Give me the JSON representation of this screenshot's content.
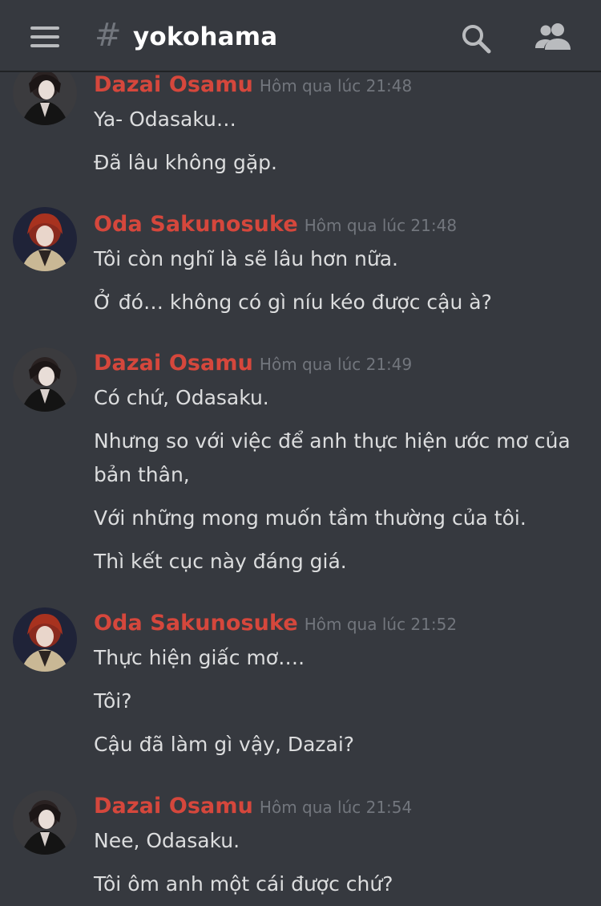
{
  "channel": {
    "hash": "#",
    "name": "yokohama"
  },
  "topbar": {
    "menu_icon": "hamburger-icon",
    "search_icon": "search-icon",
    "members_icon": "members-icon"
  },
  "colors": {
    "background": "#36393f",
    "author": "#d5473c",
    "timestamp": "#72767d",
    "text": "#dcddde",
    "header_border": "#202225"
  },
  "messages": [
    {
      "author": "Dazai Osamu",
      "timestamp": "Hôm qua lúc 21:48",
      "lines": [
        "Ya- Odasaku…",
        "Đã lâu không gặp."
      ]
    },
    {
      "author": "Oda Sakunosuke",
      "timestamp": "Hôm qua lúc 21:48",
      "lines": [
        "Tôi còn nghĩ là sẽ lâu hơn nữa.",
        "Ở đó… không có gì níu kéo được cậu à?"
      ]
    },
    {
      "author": "Dazai Osamu",
      "timestamp": "Hôm qua lúc 21:49",
      "lines": [
        "Có chứ, Odasaku.",
        "Nhưng so với việc để anh thực hiện ước mơ của bản thân,",
        "Với những mong muốn tầm thường của tôi.",
        "Thì kết cục này đáng giá."
      ]
    },
    {
      "author": "Oda Sakunosuke",
      "timestamp": "Hôm qua lúc 21:52",
      "lines": [
        "Thực hiện giấc mơ….",
        "Tôi?",
        "Cậu đã làm gì vậy, Dazai?"
      ]
    },
    {
      "author": "Dazai Osamu",
      "timestamp": "Hôm qua lúc 21:54",
      "lines": [
        "Nee, Odasaku.",
        "Tôi ôm anh một cái được chứ?"
      ]
    }
  ]
}
